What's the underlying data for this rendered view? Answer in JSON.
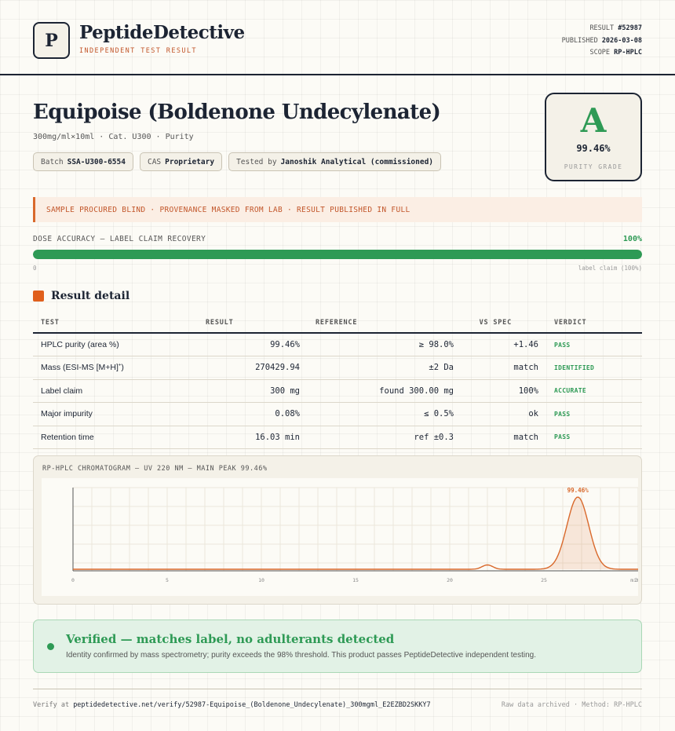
{
  "header": {
    "logo_letter": "P",
    "brand": "PeptideDetective",
    "brand_sub": "INDEPENDENT TEST RESULT",
    "result_label": "RESULT",
    "result_value": "#52987",
    "published_label": "PUBLISHED",
    "published_value": "2026-03-08",
    "scope_label": "SCOPE",
    "scope_value": "RP-HPLC"
  },
  "product": {
    "title": "Equipoise (Boldenone Undecylenate)",
    "subline": "300mg/ml×10ml · Cat. U300 · Purity",
    "chips": [
      {
        "label": "Batch",
        "value": "SSA-U300-6554"
      },
      {
        "label": "CAS",
        "value": "Proprietary"
      },
      {
        "label": "Tested by",
        "value": "Janoshik Analytical (commissioned)"
      }
    ]
  },
  "grade": {
    "letter": "A",
    "value": "99.46%",
    "label": "PURITY GRADE",
    "color": "#2e9a55"
  },
  "banner": "SAMPLE PROCURED BLIND · PROVENANCE MASKED FROM LAB · RESULT PUBLISHED IN FULL",
  "dose": {
    "label": "DOSE ACCURACY — LABEL CLAIM RECOVERY",
    "percent_text": "100%",
    "fill_fraction": 1.0,
    "left_tick": "0",
    "right_tick": "label claim (100%)"
  },
  "section_title": "Result detail",
  "table": {
    "headers": [
      "TEST",
      "RESULT",
      "REFERENCE",
      "VS SPEC",
      "VERDICT"
    ],
    "rows": [
      {
        "test": "HPLC purity (area %)",
        "result": "99.46%",
        "reference": "≥ 98.0%",
        "vs": "+1.46",
        "verdict": "PASS"
      },
      {
        "test": "Mass (ESI-MS [M+H]",
        "test_sup": "+",
        "test_tail": ")",
        "result": "270429.94",
        "reference": "±2 Da",
        "vs": "match",
        "verdict": "IDENTIFIED"
      },
      {
        "test": "Label claim",
        "result": "300 mg",
        "reference": "found 300.00 mg",
        "vs": "100%",
        "verdict": "ACCURATE"
      },
      {
        "test": "Major impurity",
        "result": "0.08%",
        "reference": "≤ 0.5%",
        "vs": "ok",
        "verdict": "PASS"
      },
      {
        "test": "Retention time",
        "result": "16.03 min",
        "reference": "ref ±0.3",
        "vs": "match",
        "verdict": "PASS"
      }
    ]
  },
  "chart_data": {
    "type": "line",
    "title": "RP-HPLC CHROMATOGRAM — UV 220 NM — MAIN PEAK 99.46%",
    "xlabel": "",
    "ylabel": "",
    "xlim": [
      0,
      30
    ],
    "x_ticks": [
      "0",
      "5",
      "10",
      "15",
      "20",
      "25",
      "30"
    ],
    "x_unit_label": "min",
    "peaks": [
      {
        "center": 22.0,
        "height": 0.06,
        "width": 0.28
      },
      {
        "center": 26.8,
        "height": 1.0,
        "width": 0.58,
        "label": "99.46%"
      }
    ],
    "baseline": 0.0,
    "grid": true,
    "line_color": "#d9692c"
  },
  "verified": {
    "title": "Verified — matches label, no adulterants detected",
    "description": "Identity confirmed by mass spectrometry; purity exceeds the 98% threshold. This product passes PeptideDetective independent testing."
  },
  "footer": {
    "verify_prefix": "Verify at",
    "verify_url": "peptidedetective.net/verify/52987-Equipoise_(Boldenone_Undecylenate)_300mgml_E2EZBD2SKKY7",
    "right_text": "Raw data archived · Method: RP-HPLC"
  }
}
